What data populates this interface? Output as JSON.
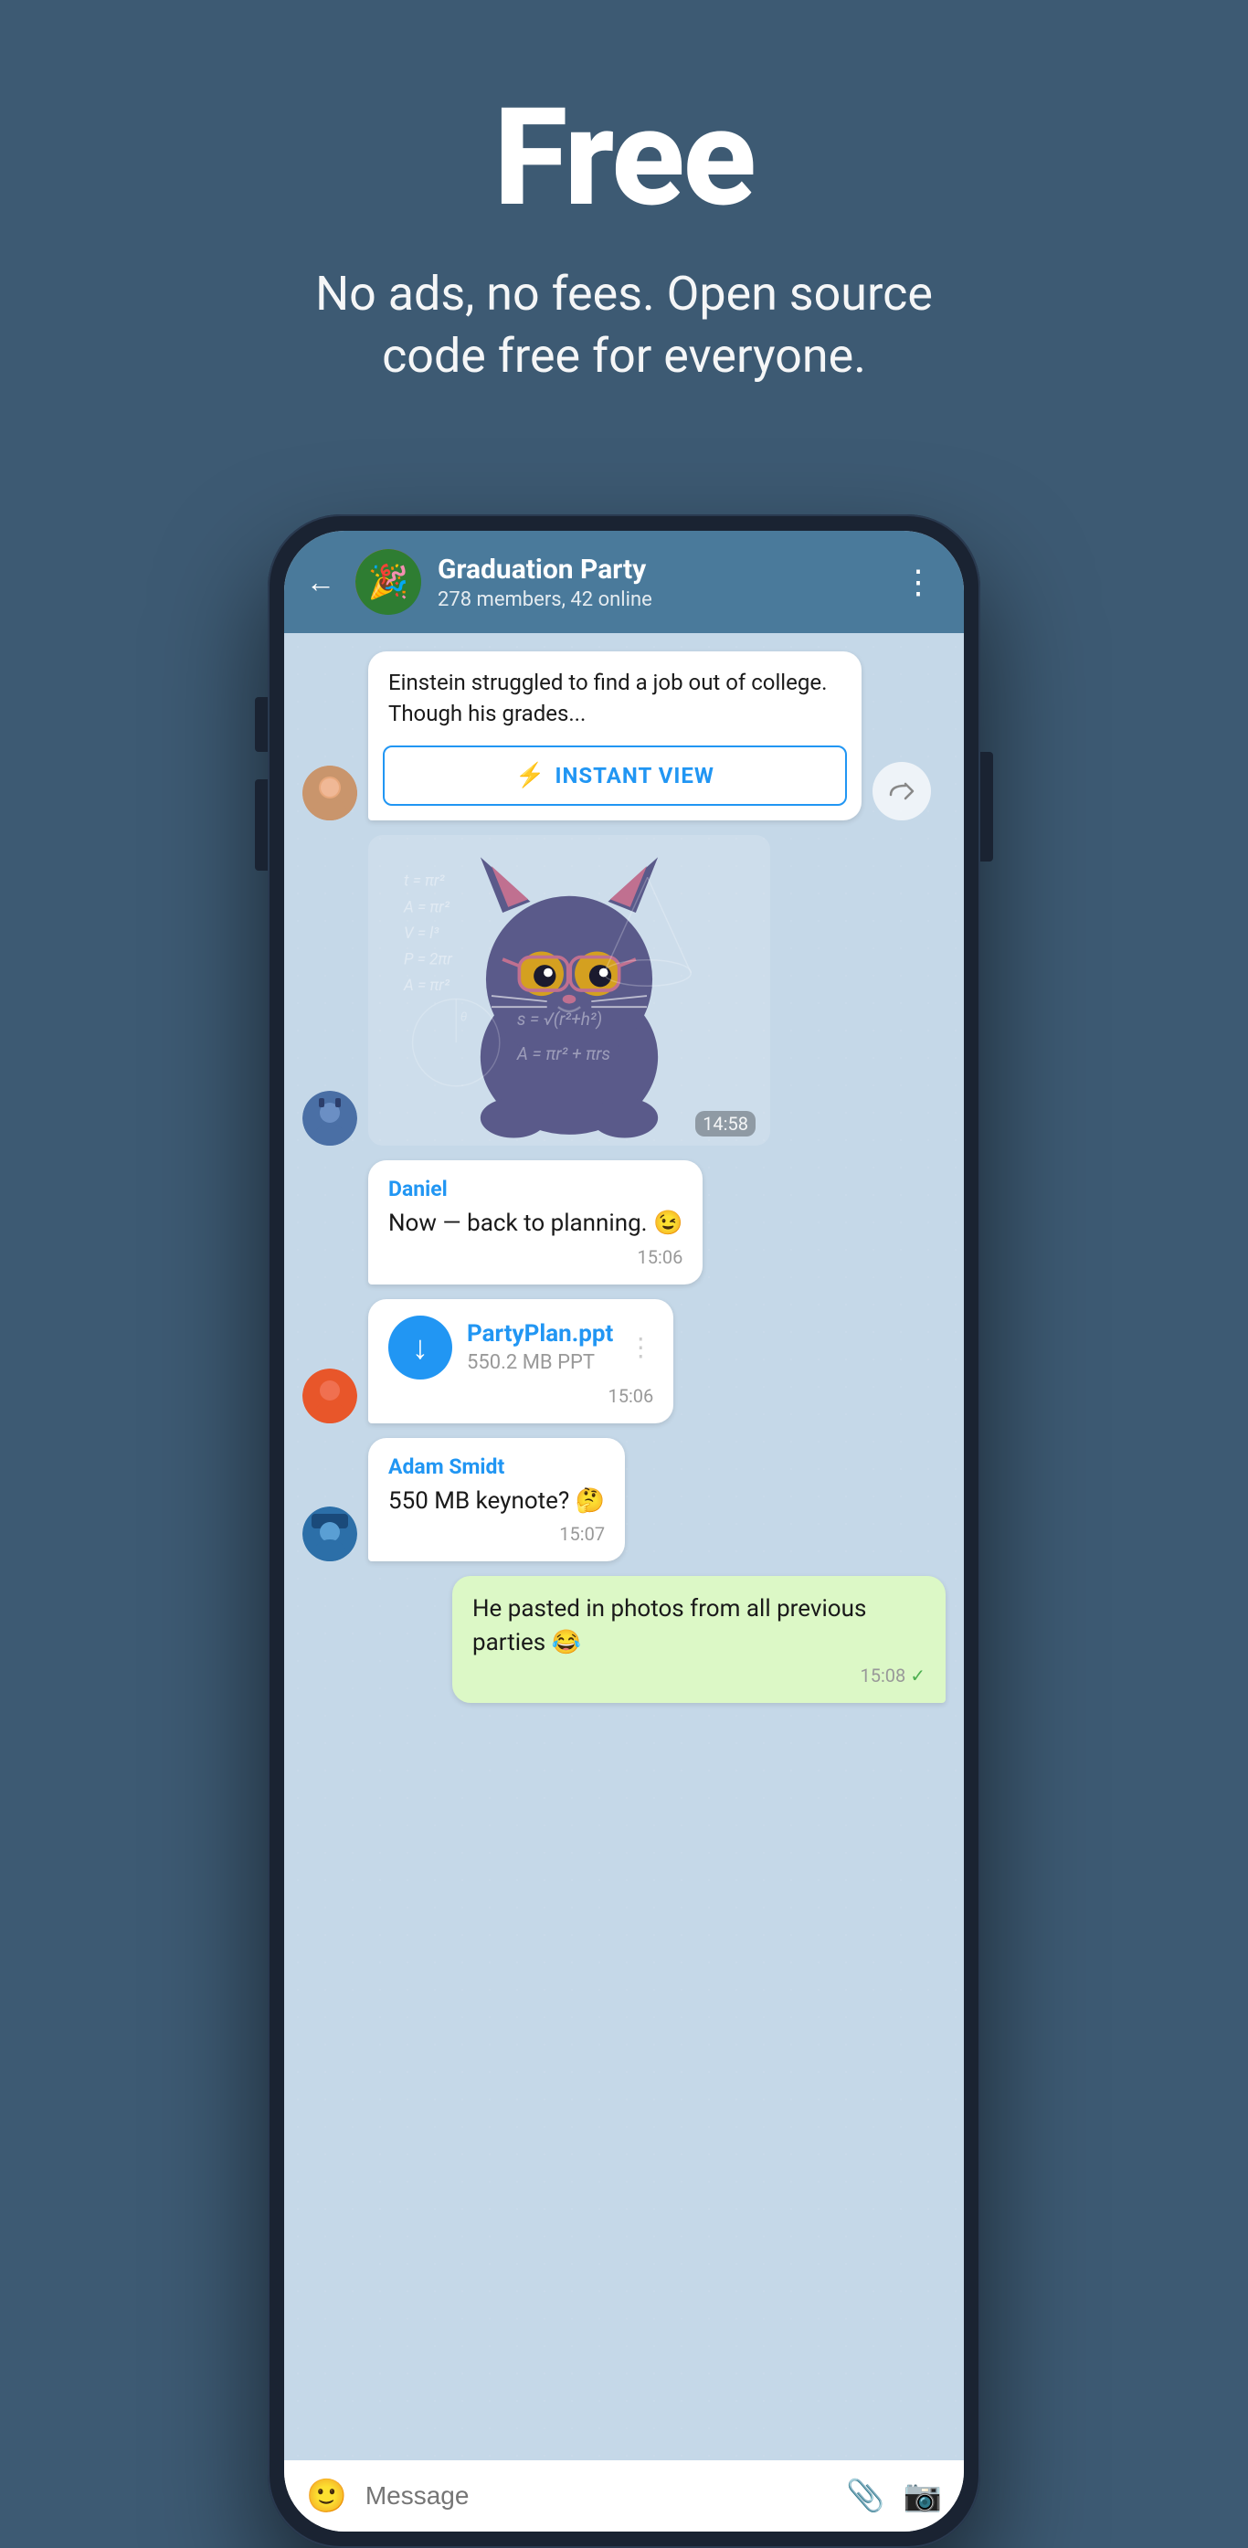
{
  "hero": {
    "title": "Free",
    "subtitle": "No ads, no fees. Open source code free for everyone."
  },
  "header": {
    "group_name": "Graduation Party",
    "group_members": "278 members, 42 online",
    "back_label": "←",
    "more_label": "⋮"
  },
  "messages": [
    {
      "id": "msg1",
      "type": "link_preview",
      "text": "Einstein struggled to find a job out of college. Though his grades...",
      "instant_view_label": "INSTANT VIEW",
      "has_avatar": true,
      "avatar_class": "avatar-img-1",
      "avatar_emoji": "👩"
    },
    {
      "id": "msg2",
      "type": "sticker",
      "time": "14:58",
      "has_avatar": true,
      "avatar_class": "avatar-img-2",
      "avatar_emoji": "👦"
    },
    {
      "id": "msg3",
      "type": "text",
      "sender": "Daniel",
      "text": "Now — back to planning. 😉",
      "time": "15:06",
      "has_avatar": false
    },
    {
      "id": "msg4",
      "type": "file",
      "file_name": "PartyPlan.ppt",
      "file_meta": "550.2 MB PPT",
      "time": "15:06",
      "has_avatar": true,
      "avatar_class": "avatar-img-3",
      "avatar_emoji": "👨"
    },
    {
      "id": "msg5",
      "type": "text",
      "sender": "Adam Smidt",
      "text": "550 MB keynote? 🤔",
      "time": "15:07",
      "has_avatar": true,
      "avatar_class": "avatar-img-4",
      "avatar_emoji": "🧢"
    },
    {
      "id": "msg6",
      "type": "outgoing",
      "text": "He pasted in photos from all previous parties 😂",
      "time": "15:08",
      "check": true
    }
  ],
  "input_bar": {
    "placeholder": "Message"
  },
  "colors": {
    "header_bg": "#4a7a9b",
    "chat_bg": "#c5d8e8",
    "body_bg": "#3d5a73",
    "bubble_outgoing": "#dcf8c6",
    "bubble_incoming": "#ffffff",
    "accent": "#2196f3"
  }
}
